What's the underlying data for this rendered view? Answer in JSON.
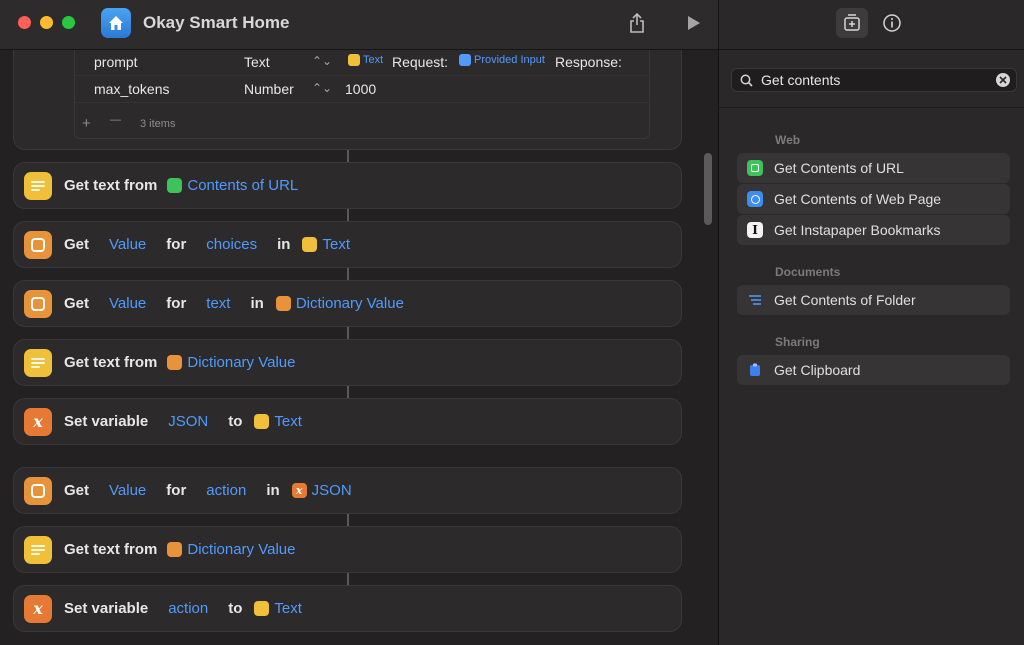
{
  "app": {
    "title": "Okay Smart Home"
  },
  "parameters": {
    "rows": [
      {
        "key": "prompt",
        "type": "Text",
        "value_tokens": {
          "t1": "Text",
          "l1": "Request:",
          "t2": "Provided Input",
          "l2": "Response:"
        }
      },
      {
        "key": "max_tokens",
        "type": "Number",
        "value": "1000"
      }
    ],
    "add_symbol": "+",
    "remove_symbol": "—",
    "count_label": "3 items"
  },
  "actions": [
    {
      "words": [
        "Get text from"
      ],
      "tokens": [
        "Contents of URL"
      ]
    },
    {
      "words": [
        "Get",
        "for",
        "in"
      ],
      "tokens": [
        "Value",
        "choices",
        "Text"
      ]
    },
    {
      "words": [
        "Get",
        "for",
        "in"
      ],
      "tokens": [
        "Value",
        "text",
        "Dictionary Value"
      ]
    },
    {
      "words": [
        "Get text from"
      ],
      "tokens": [
        "Dictionary Value"
      ]
    },
    {
      "words": [
        "Set variable",
        "to"
      ],
      "tokens": [
        "JSON",
        "Text"
      ]
    },
    {
      "words": [
        "Get",
        "for",
        "in"
      ],
      "tokens": [
        "Value",
        "action",
        "JSON"
      ]
    },
    {
      "words": [
        "Get text from"
      ],
      "tokens": [
        "Dictionary Value"
      ]
    },
    {
      "words": [
        "Set variable",
        "to"
      ],
      "tokens": [
        "action",
        "Text"
      ]
    }
  ],
  "sidebar": {
    "search": {
      "value": "Get contents"
    },
    "sections": [
      {
        "title": "Web",
        "items": [
          "Get Contents of URL",
          "Get Contents of Web Page",
          "Get Instapaper Bookmarks"
        ]
      },
      {
        "title": "Documents",
        "items": [
          "Get Contents of Folder"
        ]
      },
      {
        "title": "Sharing",
        "items": [
          "Get Clipboard"
        ]
      }
    ]
  },
  "colors": {
    "accent": "#4f9bff",
    "text_icon": "#f0c03a",
    "dict_icon": "#e8923a",
    "var_icon": "#e67a35"
  }
}
